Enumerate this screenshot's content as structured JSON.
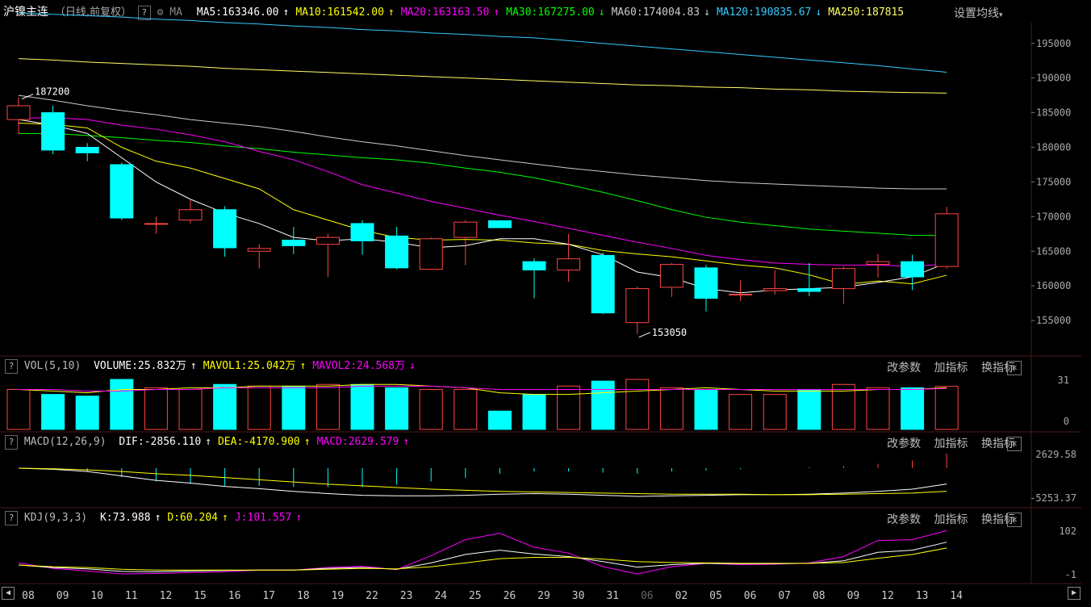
{
  "header": {
    "title": "沪镍主连",
    "mode": "（日线,前复权）",
    "question": "?",
    "ma_label": "MA",
    "settings_label": "设置均线",
    "ma_items": [
      {
        "text": "MA5:163346.00",
        "arrow": "↑",
        "color": "#ffffff"
      },
      {
        "text": "MA10:161542.00",
        "arrow": "↑",
        "color": "#ffff00"
      },
      {
        "text": "MA20:163163.50",
        "arrow": "↑",
        "color": "#ff00ff"
      },
      {
        "text": "MA30:167275.00",
        "arrow": "↓",
        "color": "#00ff00"
      },
      {
        "text": "MA60:174004.83",
        "arrow": "↓",
        "color": "#cccccc"
      },
      {
        "text": "MA120:190835.67",
        "arrow": "↓",
        "color": "#33ccff"
      },
      {
        "text": "MA250:187815",
        "arrow": "",
        "color": "#ffff66"
      }
    ]
  },
  "colors": {
    "up": "#ff4444",
    "down": "#00ffff",
    "ma5": "#ffffff",
    "ma10": "#ffff00",
    "ma20": "#ff00ff",
    "ma30": "#00ff00",
    "ma60": "#cccccc",
    "ma120": "#33ccff",
    "ma250": "#ffff66"
  },
  "panels": {
    "vol": {
      "label": "VOL(5,10)",
      "items": [
        {
          "text": "VOLUME:25.832万",
          "arrow": "↑",
          "color": "#ffffff"
        },
        {
          "text": "MAVOL1:25.042万",
          "arrow": "↑",
          "color": "#ffff00"
        },
        {
          "text": "MAVOL2:24.568万",
          "arrow": "↓",
          "color": "#ff00ff"
        }
      ]
    },
    "macd": {
      "label": "MACD(12,26,9)",
      "items": [
        {
          "text": "DIF:-2856.110",
          "arrow": "↑",
          "color": "#ffffff"
        },
        {
          "text": "DEA:-4170.900",
          "arrow": "↑",
          "color": "#ffff00"
        },
        {
          "text": "MACD:2629.579",
          "arrow": "↑",
          "color": "#ff00ff"
        }
      ]
    },
    "kdj": {
      "label": "KDJ(9,3,3)",
      "items": [
        {
          "text": "K:73.988",
          "arrow": "↑",
          "color": "#ffffff"
        },
        {
          "text": "D:60.204",
          "arrow": "↑",
          "color": "#ffff00"
        },
        {
          "text": "J:101.557",
          "arrow": "↑",
          "color": "#ff00ff"
        }
      ]
    },
    "tools": {
      "params": "改参数",
      "add": "加指标",
      "switch": "换指标",
      "close": "✕"
    }
  },
  "axis": {
    "price_ticks": [
      "195000",
      "190000",
      "185000",
      "180000",
      "175000",
      "170000",
      "165000",
      "160000",
      "155000"
    ],
    "vol_ticks": [
      "31",
      "0"
    ],
    "macd_ticks": [
      "2629.58",
      "-5253.37"
    ],
    "kdj_ticks": [
      "102",
      "-1"
    ],
    "dates": [
      "08",
      "09",
      "10",
      "11",
      "12",
      "15",
      "16",
      "17",
      "18",
      "19",
      "22",
      "23",
      "24",
      "25",
      "26",
      "29",
      "30",
      "31",
      "06",
      "02",
      "05",
      "06",
      "07",
      "08",
      "09",
      "12",
      "13",
      "14"
    ],
    "high_label": "187200",
    "low_label": "153050"
  },
  "chart_data": {
    "type": "candlestick",
    "ylim": [
      150000,
      198000
    ],
    "candles": [
      {
        "o": 184000,
        "h": 187200,
        "l": 182000,
        "c": 186000
      },
      {
        "o": 185000,
        "h": 186000,
        "l": 179000,
        "c": 179600
      },
      {
        "o": 180000,
        "h": 180600,
        "l": 178000,
        "c": 179200
      },
      {
        "o": 177500,
        "h": 177800,
        "l": 169500,
        "c": 169800
      },
      {
        "o": 169000,
        "h": 170000,
        "l": 167500,
        "c": 169000
      },
      {
        "o": 169500,
        "h": 172500,
        "l": 169000,
        "c": 171000
      },
      {
        "o": 171000,
        "h": 171500,
        "l": 164200,
        "c": 165500
      },
      {
        "o": 165000,
        "h": 166000,
        "l": 162500,
        "c": 165400
      },
      {
        "o": 166600,
        "h": 168500,
        "l": 164600,
        "c": 165800
      },
      {
        "o": 166000,
        "h": 167500,
        "l": 161300,
        "c": 167000
      },
      {
        "o": 169000,
        "h": 169500,
        "l": 164500,
        "c": 166500
      },
      {
        "o": 167200,
        "h": 168500,
        "l": 162400,
        "c": 162600
      },
      {
        "o": 162400,
        "h": 167000,
        "l": 162300,
        "c": 166800
      },
      {
        "o": 167000,
        "h": 169500,
        "l": 163000,
        "c": 169200
      },
      {
        "o": 169400,
        "h": 169500,
        "l": 168400,
        "c": 168400
      },
      {
        "o": 163500,
        "h": 164000,
        "l": 158200,
        "c": 162300
      },
      {
        "o": 162300,
        "h": 167500,
        "l": 160600,
        "c": 163900
      },
      {
        "o": 164400,
        "h": 164800,
        "l": 155900,
        "c": 156100
      },
      {
        "o": 154700,
        "h": 159900,
        "l": 153050,
        "c": 159600
      },
      {
        "o": 159800,
        "h": 163300,
        "l": 158400,
        "c": 163100
      },
      {
        "o": 162600,
        "h": 163000,
        "l": 156300,
        "c": 158200
      },
      {
        "o": 158800,
        "h": 160800,
        "l": 157800,
        "c": 158800
      },
      {
        "o": 159300,
        "h": 162300,
        "l": 158700,
        "c": 159600
      },
      {
        "o": 159600,
        "h": 163300,
        "l": 158500,
        "c": 159200
      },
      {
        "o": 159600,
        "h": 162800,
        "l": 157400,
        "c": 162500
      },
      {
        "o": 163100,
        "h": 164600,
        "l": 161200,
        "c": 163500
      },
      {
        "o": 163500,
        "h": 164500,
        "l": 159400,
        "c": 161300
      },
      {
        "o": 162800,
        "h": 171400,
        "l": 162500,
        "c": 170400
      }
    ],
    "ma5": [
      184000,
      183200,
      182000,
      178500,
      175000,
      172500,
      170500,
      169000,
      167000,
      166500,
      166800,
      166300,
      165500,
      165800,
      166800,
      166800,
      166000,
      164500,
      162000,
      161200,
      159600,
      159000,
      159400,
      159600,
      159800,
      160500,
      161300,
      163346
    ],
    "ma10": [
      183500,
      183300,
      182800,
      180000,
      178000,
      177000,
      175500,
      174000,
      171000,
      169500,
      168000,
      167000,
      166600,
      166700,
      166600,
      166200,
      166000,
      165100,
      164600,
      164200,
      163600,
      163000,
      162600,
      161600,
      160200,
      160700,
      160300,
      161542
    ],
    "ma20": [
      184200,
      184300,
      184000,
      183200,
      182600,
      181800,
      180800,
      179400,
      178200,
      176500,
      174600,
      173400,
      172200,
      171200,
      170200,
      169300,
      168300,
      167300,
      166300,
      165400,
      164400,
      163800,
      163300,
      163100,
      163000,
      163000,
      162800,
      163163.5
    ],
    "ma30": [
      182000,
      182000,
      181700,
      181400,
      181000,
      180700,
      180200,
      179800,
      179300,
      178900,
      178500,
      178200,
      177700,
      177000,
      176400,
      175600,
      174600,
      173500,
      172300,
      171000,
      169900,
      169200,
      168700,
      168200,
      167900,
      167600,
      167300,
      167275
    ],
    "ma60": [
      187500,
      186800,
      186000,
      185300,
      184700,
      184000,
      183500,
      183000,
      182300,
      181500,
      180800,
      180200,
      179500,
      178800,
      178200,
      177600,
      177000,
      176500,
      176000,
      175600,
      175200,
      174900,
      174700,
      174500,
      174300,
      174100,
      174000,
      174004.83
    ],
    "ma120": [
      199400,
      199200,
      199000,
      198800,
      198500,
      198300,
      198000,
      197800,
      197500,
      197300,
      197000,
      196800,
      196500,
      196300,
      196000,
      195800,
      195400,
      195000,
      194600,
      194200,
      193800,
      193400,
      193000,
      192600,
      192200,
      191800,
      191300,
      190835.67
    ],
    "ma250": [
      192800,
      192600,
      192300,
      192100,
      191900,
      191700,
      191400,
      191200,
      191000,
      190800,
      190600,
      190400,
      190200,
      190000,
      189800,
      189600,
      189400,
      189200,
      189000,
      188900,
      188700,
      188600,
      188400,
      188300,
      188100,
      188000,
      187900,
      187815
    ],
    "volume": [
      24,
      21,
      20,
      30,
      25,
      24,
      27,
      26,
      26,
      27,
      27,
      25,
      24,
      24,
      11,
      21,
      26,
      29,
      30,
      25,
      24,
      21,
      21,
      24,
      27,
      25,
      25,
      25.832
    ],
    "mavol1": [
      24,
      23,
      22,
      24,
      24,
      25,
      25,
      26,
      26,
      26,
      27,
      27,
      26,
      25,
      22,
      21,
      21,
      22,
      23,
      24,
      25,
      24,
      23,
      23,
      23,
      24,
      24,
      25.042
    ],
    "mavol2": [
      24,
      24,
      23,
      23,
      24,
      24,
      25,
      25,
      25,
      25,
      26,
      26,
      26,
      25,
      24,
      24,
      24,
      24,
      24,
      24,
      24,
      24,
      24,
      24,
      24,
      24,
      24,
      24.568
    ],
    "dif": [
      0,
      -200,
      -600,
      -1400,
      -2200,
      -2700,
      -3300,
      -3700,
      -4200,
      -4600,
      -4900,
      -5000,
      -5000,
      -4900,
      -4700,
      -4600,
      -4700,
      -4900,
      -5100,
      -5000,
      -4900,
      -4800,
      -4800,
      -4700,
      -4500,
      -4200,
      -3800,
      -2856.11
    ],
    "dea": [
      0,
      -100,
      -300,
      -600,
      -1000,
      -1300,
      -1700,
      -2100,
      -2500,
      -2900,
      -3200,
      -3500,
      -3800,
      -4000,
      -4200,
      -4300,
      -4400,
      -4500,
      -4600,
      -4700,
      -4700,
      -4700,
      -4800,
      -4800,
      -4700,
      -4600,
      -4500,
      -4170.9
    ],
    "macd": [
      0,
      -200,
      -600,
      -1600,
      -2400,
      -2800,
      -3200,
      -3200,
      -3400,
      -3400,
      -3400,
      -3000,
      -2400,
      -1800,
      -1000,
      -600,
      -600,
      -800,
      -1000,
      -600,
      -400,
      -200,
      0,
      200,
      400,
      800,
      1400,
      2629.579
    ],
    "k": [
      20,
      14,
      11,
      5,
      4,
      6,
      7,
      8,
      8,
      12,
      14,
      10,
      25,
      45,
      55,
      46,
      40,
      28,
      15,
      21,
      24,
      23,
      23,
      24,
      30,
      50,
      55,
      73.988
    ],
    "d": [
      20,
      16,
      14,
      10,
      8,
      8,
      8,
      8,
      8,
      10,
      12,
      11,
      16,
      25,
      35,
      38,
      38,
      34,
      28,
      26,
      25,
      24,
      24,
      24,
      26,
      36,
      45,
      60.204
    ],
    "j": [
      25,
      12,
      6,
      -1,
      0,
      2,
      4,
      8,
      8,
      14,
      17,
      9,
      42,
      80,
      95,
      62,
      48,
      16,
      -1,
      16,
      24,
      21,
      22,
      25,
      40,
      78,
      80,
      101.557
    ]
  }
}
